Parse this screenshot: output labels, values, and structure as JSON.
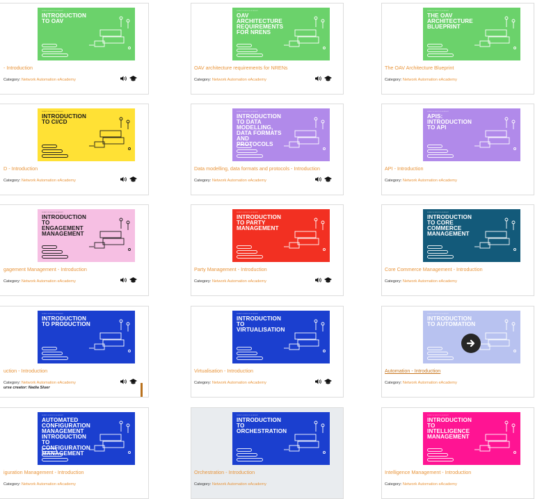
{
  "header_label": "SUBMIT A SERVICE ACADEMY",
  "category_label": "Category:",
  "category_value": "Network Automation eAcademy",
  "cards": [
    {
      "title": "- Introduction",
      "thumb_title": "INTRODUCTION TO OAV",
      "bg": "#6bd26b",
      "dark": false,
      "show_icons": true
    },
    {
      "title": "OAV architecture requirements for NRENs",
      "thumb_title": "OAV ARCHITECTURE REQUIREMENTS FOR NRENs",
      "bg": "#6bd26b",
      "dark": false,
      "show_icons": true
    },
    {
      "title": "The OAV Architecture Blueprint",
      "thumb_title": "THE OAV ARCHITECTURE BLUEPRINT",
      "bg": "#6bd26b",
      "dark": false,
      "show_icons": false
    },
    {
      "title": "D - Introduction",
      "thumb_title": "INTRODUCTION TO CI/CD",
      "bg": "#ffe135",
      "dark": true,
      "show_icons": true
    },
    {
      "title": "Data modelling, data formats and protocols - Introduction",
      "thumb_title": "INTRODUCTION TO DATA MODELLING, DATA FORMATS AND PROTOCOLS",
      "bg": "#b18aea",
      "dark": false,
      "show_icons": true
    },
    {
      "title": "API - Introduction",
      "thumb_title": "APIs: INTRODUCTION TO API",
      "bg": "#b18aea",
      "dark": false,
      "show_icons": false
    },
    {
      "title": "gagement Management - Introduction",
      "thumb_title": "INTRODUCTION TO ENGAGEMENT MANAGEMENT",
      "bg": "#f6bfe3",
      "dark": true,
      "show_icons": true
    },
    {
      "title": "Party Management - Introduction",
      "thumb_title": "INTRODUCTION TO PARTY MANAGEMENT",
      "bg": "#f23022",
      "dark": false,
      "show_icons": true
    },
    {
      "title": "Core Commerce Management - Introduction",
      "thumb_title": "INTRODUCTION TO CORE COMMERCE MANAGEMENT",
      "bg": "#135a7a",
      "dark": false,
      "show_icons": false
    },
    {
      "title": "uction - Introduction",
      "thumb_title": "INTRODUCTION TO PRODUCTION",
      "bg": "#1b3fcf",
      "dark": false,
      "show_icons": true,
      "creator": "urse creator: Nadia Sluer"
    },
    {
      "title": "Virtualisation - Introduction",
      "thumb_title": "INTRODUCTION TO VIRTUALISATION",
      "bg": "#1b3fcf",
      "dark": false,
      "show_icons": true
    },
    {
      "title": "Automation - Introduction",
      "thumb_title": "INTRODUCTION TO AUTOMATION",
      "bg": "#b5bff0",
      "dark": false,
      "show_icons": false,
      "active": true
    },
    {
      "title": "iguration Management - Introduction",
      "thumb_title": "AUTOMATED CONFIGURATION MANAGEMENT INTRODUCTION TO CONFIGURATION MANAGEMENT",
      "bg": "#1b3fcf",
      "dark": false,
      "show_icons": false
    },
    {
      "title": "Orchestration - Introduction",
      "thumb_title": "INTRODUCTION TO ORCHESTRATION",
      "bg": "#1b3fcf",
      "dark": false,
      "show_icons": false,
      "greyed": true
    },
    {
      "title": "Intelligence Management - Introduction",
      "thumb_title": "INTRODUCTION TO INTELLIGENCE MANAGEMENT",
      "bg": "#ff1493",
      "dark": false,
      "show_icons": false
    }
  ],
  "icons": {
    "audio": "speaker-icon",
    "course": "graduation-cap-icon",
    "go": "arrow-right-circle-icon"
  }
}
